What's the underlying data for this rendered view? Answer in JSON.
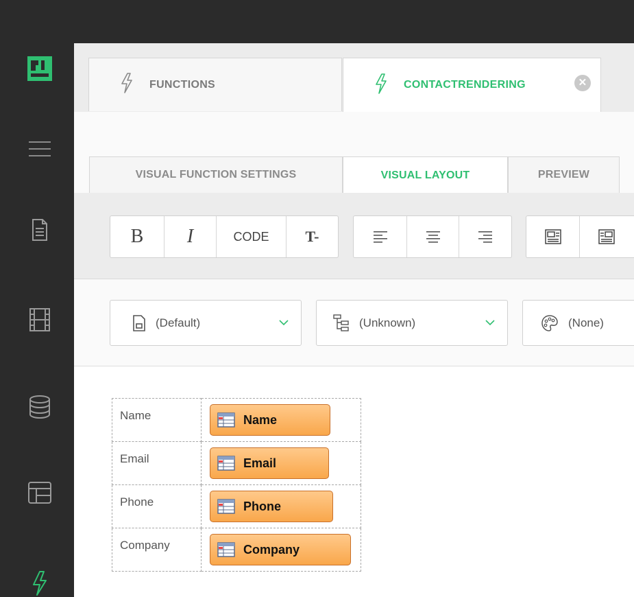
{
  "rail": {
    "icons": [
      "logo-icon",
      "menu-icon",
      "document-icon",
      "film-icon",
      "database-icon",
      "layout-icon",
      "function-icon"
    ],
    "active_color": "#2fbf71"
  },
  "doc_tabs": [
    {
      "label": "FUNCTIONS",
      "active": false
    },
    {
      "label": "CONTACTRENDERING",
      "active": true
    }
  ],
  "sub_tabs": [
    {
      "label": "VISUAL FUNCTION SETTINGS",
      "active": false
    },
    {
      "label": "VISUAL LAYOUT",
      "active": true
    },
    {
      "label": "PREVIEW",
      "active": false
    }
  ],
  "toolbar": {
    "bold_label": "B",
    "italic_label": "I",
    "code_label": "CODE",
    "text_size_label": "T-"
  },
  "dropdowns": [
    {
      "value": "(Default)",
      "icon": "page-template-icon"
    },
    {
      "value": "(Unknown)",
      "icon": "hierarchy-icon"
    },
    {
      "value": "(None)",
      "icon": "palette-icon"
    }
  ],
  "layout_rows": [
    {
      "label": "Name",
      "field": "Name"
    },
    {
      "label": "Email",
      "field": "Email"
    },
    {
      "label": "Phone",
      "field": "Phone"
    },
    {
      "label": "Company",
      "field": "Company"
    }
  ],
  "colors": {
    "accent": "#2fbf71",
    "chip_top": "#ffc98a",
    "chip_bottom": "#f9a74b",
    "rail": "#2b2b2b"
  }
}
